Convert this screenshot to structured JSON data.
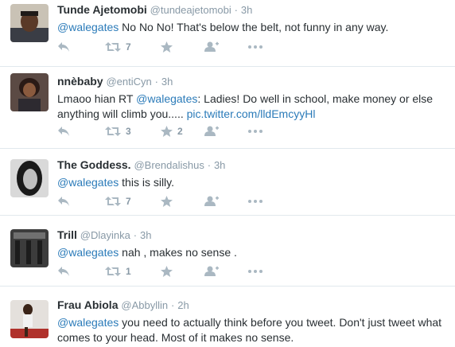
{
  "tweets": [
    {
      "name": "Tunde Ajetomobi",
      "handle": "@tundeajetomobi",
      "separator": "·",
      "time": "3h",
      "mention": "@walegates",
      "text": " No No No! That's below the belt, not funny in any way.",
      "retweets": "7",
      "favorites": ""
    },
    {
      "name": "nnèbaby",
      "handle": "@entiCyn",
      "separator": "·",
      "time": "3h",
      "prefix": "Lmaoo hian RT ",
      "mention": "@walegates",
      "text": ": Ladies! Do well in school, make money or else anything will climb you..... ",
      "link": "pic.twitter.com/lldEmcyyHl",
      "retweets": "3",
      "favorites": "2"
    },
    {
      "name": "The Goddess.",
      "handle": "@Brendalishus",
      "separator": "·",
      "time": "3h",
      "mention": "@walegates",
      "text": " this is silly.",
      "retweets": "7",
      "favorites": ""
    },
    {
      "name": "Trill",
      "handle": "@Dlayinka",
      "separator": "·",
      "time": "3h",
      "mention": "@walegates",
      "text": " nah , makes no sense .",
      "retweets": "1",
      "favorites": ""
    },
    {
      "name": "Frau Abiola",
      "handle": "@Abbyllin",
      "separator": "·",
      "time": "2h",
      "mention": "@walegates",
      "text": " you need to actually think before you tweet. Don't just tweet what comes to your head. Most of it makes no sense.",
      "retweets": "",
      "favorites": ""
    }
  ],
  "icons": {
    "reply": "reply-icon",
    "retweet": "retweet-icon",
    "favorite": "star-icon",
    "follow": "follow-user-icon",
    "more": "more-dots-icon"
  },
  "colors": {
    "link": "#2b7bb9",
    "meta": "#8899a6",
    "action_icon": "#aab8c2",
    "divider": "#e1e8ed"
  }
}
